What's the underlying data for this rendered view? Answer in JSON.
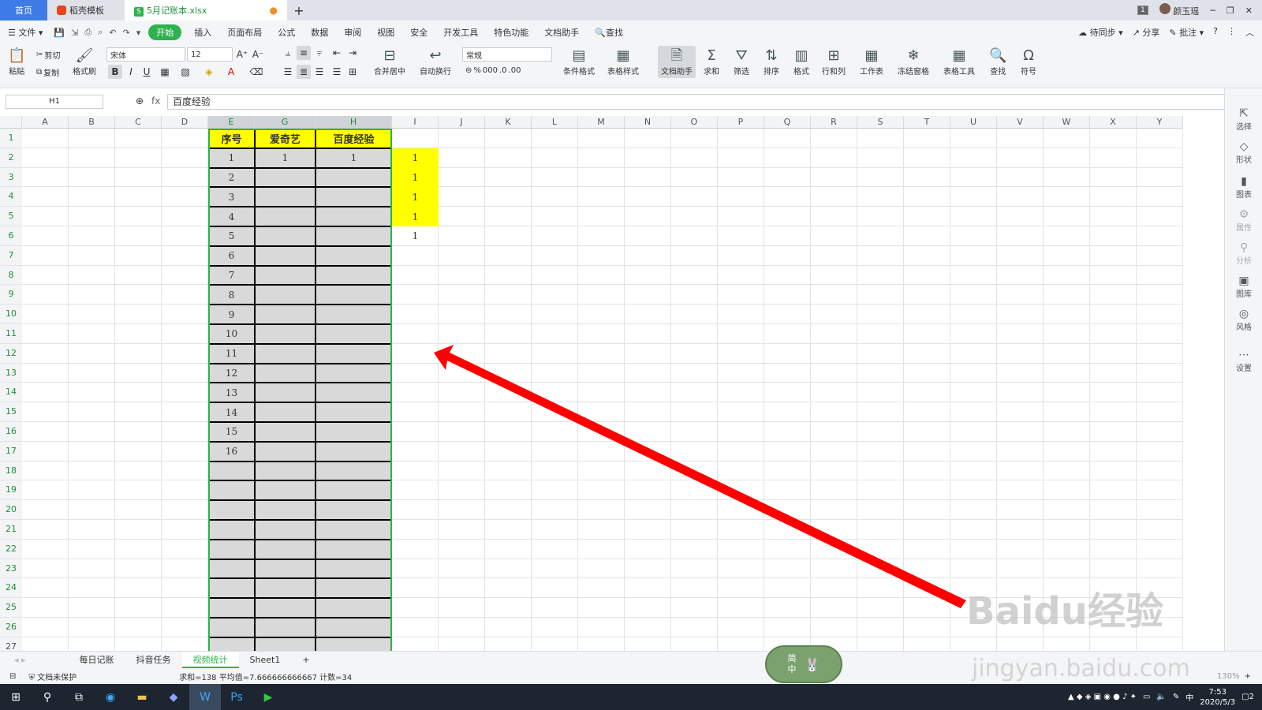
{
  "tabs": {
    "home": "首页",
    "template": "稻壳模板",
    "file": "5月记账本.xlsx",
    "add": "+"
  },
  "titlebar": {
    "page_badge": "1",
    "user": "颜玉瑶"
  },
  "menu": {
    "file": "文件",
    "items": [
      "开始",
      "插入",
      "页面布局",
      "公式",
      "数据",
      "审阅",
      "视图",
      "安全",
      "开发工具",
      "特色功能",
      "文档助手"
    ],
    "search": "查找",
    "right": [
      "待同步",
      "分享",
      "批注"
    ]
  },
  "ribbon": {
    "paste": "粘贴",
    "cut": "剪切",
    "copy": "复制",
    "format_painter": "格式刷",
    "font_name": "宋体",
    "font_size": "12",
    "merge": "合并居中",
    "wrap": "自动换行",
    "number_format": "常规",
    "cond_format": "条件格式",
    "table_style": "表格样式",
    "doc_assist": "文档助手",
    "sum": "求和",
    "filter": "筛选",
    "sort": "排序",
    "format": "格式",
    "rowcol": "行和列",
    "worksheet": "工作表",
    "freeze": "冻结窗格",
    "table_tools": "表格工具",
    "find": "查找",
    "symbol": "符号"
  },
  "formula": {
    "name_box": "H1",
    "fx": "fx",
    "content": "百度经验"
  },
  "columns": [
    "A",
    "B",
    "C",
    "D",
    "E",
    "G",
    "H",
    "I",
    "J",
    "K",
    "L",
    "M",
    "N",
    "O",
    "P",
    "Q",
    "R",
    "S",
    "T",
    "U",
    "V",
    "W",
    "X",
    "Y"
  ],
  "rows": [
    "1",
    "2",
    "3",
    "4",
    "5",
    "6",
    "7",
    "8",
    "9",
    "10",
    "11",
    "12",
    "13",
    "14",
    "15",
    "16",
    "17",
    "18",
    "19",
    "20",
    "21",
    "22",
    "23",
    "24",
    "25",
    "26",
    "27"
  ],
  "table": {
    "headers": [
      "序号",
      "爱奇艺",
      "百度经验"
    ],
    "serials": [
      "1",
      "2",
      "3",
      "4",
      "5",
      "6",
      "7",
      "8",
      "9",
      "10",
      "11",
      "12",
      "13",
      "14",
      "15",
      "16"
    ],
    "g2": "1",
    "h2": "1"
  },
  "col_i_values": [
    "1",
    "1",
    "1",
    "1",
    "1"
  ],
  "right_panel": [
    "选择",
    "形状",
    "图表",
    "属性",
    "分析",
    "图库",
    "风格",
    "设置"
  ],
  "sheet_tabs": [
    "每日记账",
    "抖音任务",
    "视频统计",
    "Sheet1"
  ],
  "status": {
    "protect": "文档未保护",
    "summary": "求和=138  平均值=7.666666666667  计数=34",
    "zoom": "130%"
  },
  "ime_float": {
    "top": "简",
    "bottom": "中"
  },
  "taskbar": {
    "time": "7:53",
    "date": "2020/5/3",
    "lang": "中",
    "notif": "2"
  },
  "watermark": {
    "line1": "Baidu经验",
    "line2": "jingyan.baidu.com"
  },
  "colors": {
    "accent": "#2db24d",
    "header_fill": "#ffff00",
    "table_fill": "#d9d9d9",
    "arrow": "#ff0000"
  }
}
